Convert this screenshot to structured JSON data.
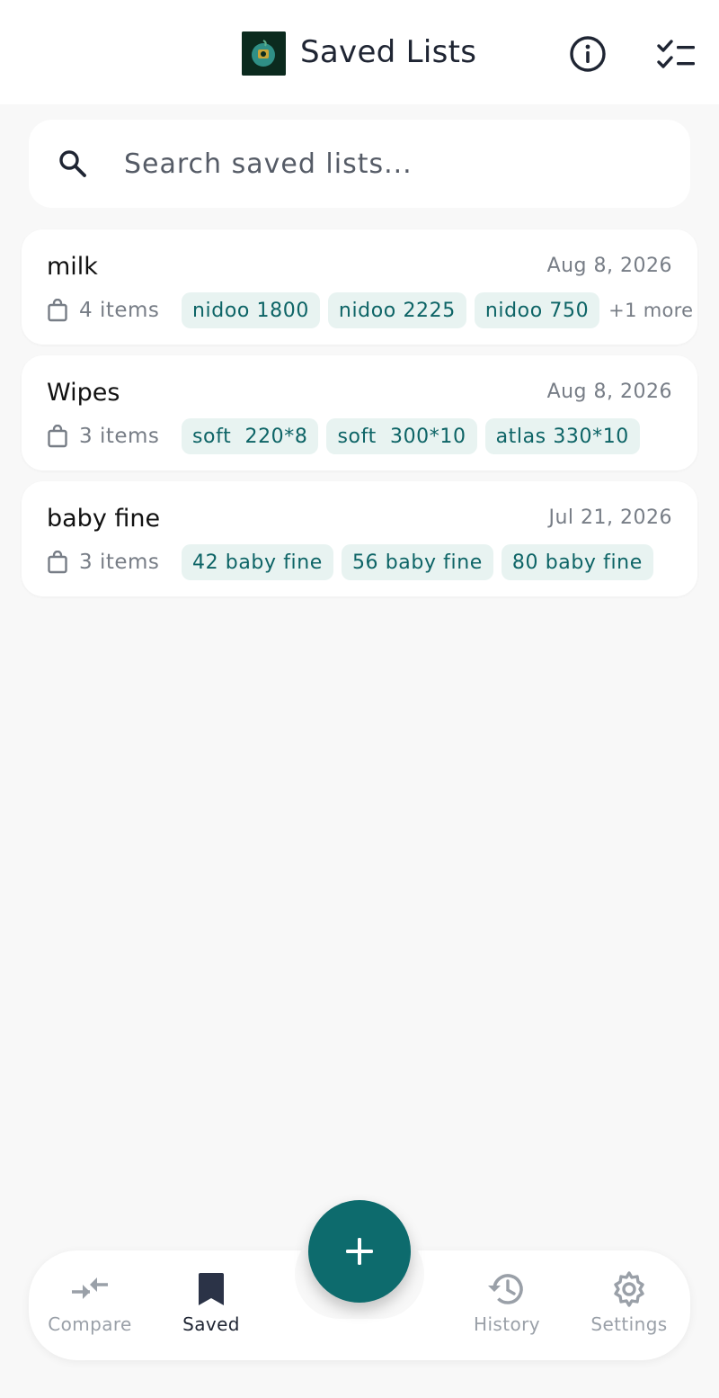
{
  "header": {
    "title": "Saved Lists",
    "logo_icon": "app-logo",
    "info_icon": "info-icon",
    "checklist_icon": "checklist-icon"
  },
  "search": {
    "placeholder": "Search saved lists...",
    "value": ""
  },
  "lists": [
    {
      "name": "milk",
      "date": "Aug 8, 2026",
      "count_label": "4 items",
      "chips": [
        "nidoo 1800",
        "nidoo 2225",
        "nidoo 750"
      ],
      "more_label": "+1 more"
    },
    {
      "name": "Wipes",
      "date": "Aug 8, 2026",
      "count_label": "3 items",
      "chips": [
        "soft  220*8",
        "soft  300*10",
        "atlas 330*10"
      ],
      "more_label": ""
    },
    {
      "name": "baby fine",
      "date": "Jul 21, 2026",
      "count_label": "3 items",
      "chips": [
        "42 baby fine",
        "56 baby fine",
        "80 baby fine"
      ],
      "more_label": ""
    }
  ],
  "bottom_nav": {
    "items": [
      {
        "label": "Compare",
        "icon": "compare-arrows-icon",
        "active": false
      },
      {
        "label": "Saved",
        "icon": "bookmark-icon",
        "active": true
      },
      {
        "label": "History",
        "icon": "history-icon",
        "active": false
      },
      {
        "label": "Settings",
        "icon": "gear-icon",
        "active": false
      }
    ],
    "fab_icon": "plus-icon"
  },
  "colors": {
    "accent": "#0d6b6d",
    "chip_bg": "#e8f3f1",
    "chip_text": "#0d6466",
    "muted_text": "#777d86",
    "background": "#f8f8f8"
  }
}
